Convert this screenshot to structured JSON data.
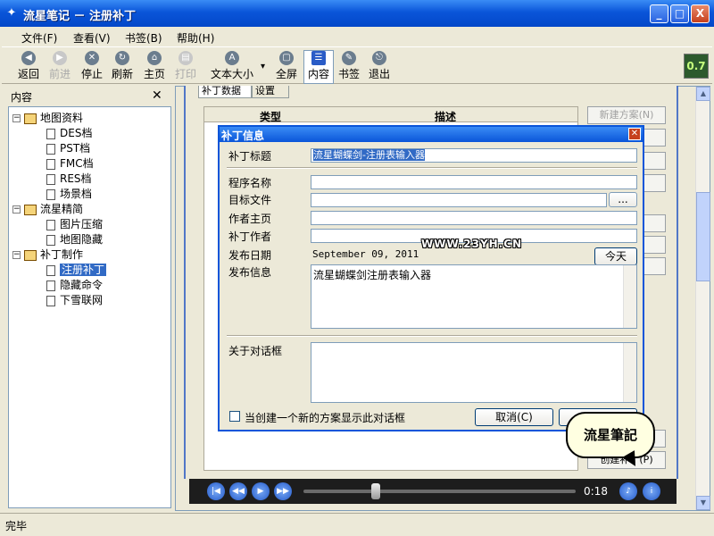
{
  "window": {
    "title": "流星笔记 － 注册补丁",
    "min_glyph": "_",
    "max_glyph": "□",
    "close_glyph": "X"
  },
  "menu": [
    "文件(F)",
    "查看(V)",
    "书签(B)",
    "帮助(H)"
  ],
  "toolbar": {
    "items": [
      {
        "label": "返回",
        "icon": "back-icon",
        "glyph": "◀",
        "disabled": false
      },
      {
        "label": "前进",
        "icon": "forward-icon",
        "glyph": "▶",
        "disabled": true
      },
      {
        "label": "停止",
        "icon": "stop-icon",
        "glyph": "✕",
        "disabled": false
      },
      {
        "label": "刷新",
        "icon": "refresh-icon",
        "glyph": "↻",
        "disabled": false
      },
      {
        "label": "主页",
        "icon": "home-icon",
        "glyph": "⌂",
        "disabled": false
      },
      {
        "label": "打印",
        "icon": "print-icon",
        "glyph": "▤",
        "disabled": true
      },
      {
        "label": "文本大小",
        "icon": "font-size-icon",
        "glyph": "A",
        "disabled": false,
        "dropdown": "▾"
      },
      {
        "label": "全屏",
        "icon": "fullscreen-icon",
        "glyph": "▢",
        "disabled": false
      },
      {
        "label": "内容",
        "icon": "contents-icon",
        "glyph": "☰",
        "disabled": false,
        "active": true
      },
      {
        "label": "书签",
        "icon": "bookmark-icon",
        "glyph": "✎",
        "disabled": false
      },
      {
        "label": "退出",
        "icon": "exit-icon",
        "glyph": "⎋",
        "disabled": false
      }
    ],
    "logo_text": "0.7"
  },
  "sidebar": {
    "title": "内容",
    "close_glyph": "✕",
    "tree": [
      {
        "label": "地图资料",
        "type": "folder",
        "expander": "⊟",
        "level": 0
      },
      {
        "label": "DES档",
        "type": "page",
        "level": 1
      },
      {
        "label": "PST档",
        "type": "page",
        "level": 1
      },
      {
        "label": "FMC档",
        "type": "page",
        "level": 1
      },
      {
        "label": "RES档",
        "type": "page",
        "level": 1
      },
      {
        "label": "场景档",
        "type": "page",
        "level": 1
      },
      {
        "label": "流星精简",
        "type": "folder",
        "expander": "⊟",
        "level": 0
      },
      {
        "label": "图片压缩",
        "type": "page",
        "level": 1
      },
      {
        "label": "地图隐藏",
        "type": "page",
        "level": 1
      },
      {
        "label": "补丁制作",
        "type": "folder",
        "expander": "⊟",
        "level": 0
      },
      {
        "label": "注册补丁",
        "type": "page",
        "level": 1,
        "selected": true
      },
      {
        "label": "隐藏命令",
        "type": "page",
        "level": 1
      },
      {
        "label": "下雪联网",
        "type": "page",
        "level": 1
      }
    ]
  },
  "content": {
    "tabs": [
      "补丁数据",
      "设置"
    ],
    "grid_headers": [
      "类型",
      "描述"
    ],
    "side_buttons": [
      "新建方案(N)",
      "D)",
      "S)",
      "C)",
      "",
      "",
      "",
      ")",
      "创建补丁(P)"
    ]
  },
  "media": {
    "time": "0:18",
    "progress_fraction": 0.27
  },
  "dialog": {
    "title": "补丁信息",
    "close_glyph": "✕",
    "fields": {
      "patch_title_label": "补丁标题",
      "patch_title_value": "流星蝴蝶剑-注册表输入器",
      "program_name_label": "程序名称",
      "program_name_value": "",
      "target_file_label": "目标文件",
      "target_file_value": "",
      "browse_label": "...",
      "author_home_label": "作者主页",
      "author_home_value": "",
      "patch_author_label": "补丁作者",
      "patch_author_value": "",
      "release_date_label": "发布日期",
      "release_date_value": "September 09, 2011",
      "today_label": "今天",
      "release_info_label": "发布信息",
      "release_info_value": "流星蝴蝶剑注册表输入器",
      "about_label": "关于对话框",
      "about_value": "",
      "checkbox_label": "当创建一个新的方案显示此对话框",
      "cancel_label": "取消(C)",
      "ok_label": ""
    }
  },
  "watermark": "WWW.23YH.CN",
  "bubble": "流星筆記",
  "status": "完毕"
}
